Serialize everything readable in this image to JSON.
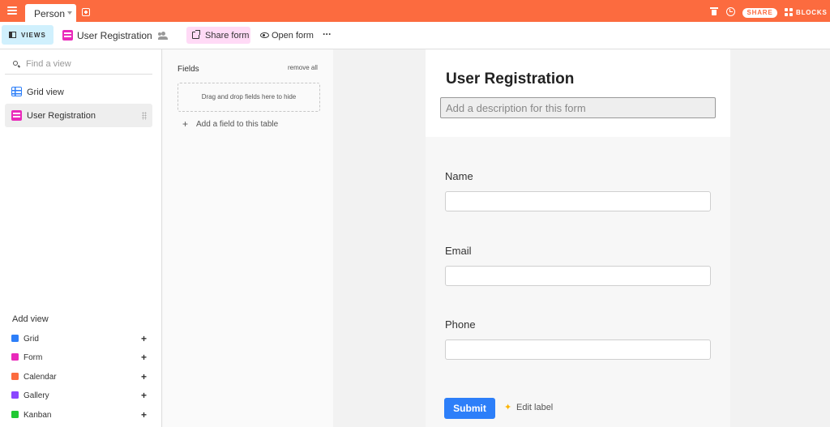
{
  "topbar": {
    "table_tab": "Person",
    "share": "SHARE",
    "blocks": "BLOCKS",
    "color": "#fc6b3f"
  },
  "viewbar": {
    "views": "VIEWS",
    "view_name": "User Registration",
    "share_form": "Share form",
    "open_form": "Open form",
    "more": "···"
  },
  "sidebar": {
    "find_placeholder": "Find a view",
    "views": [
      {
        "label": "Grid view",
        "icon": "grid-icon",
        "active": false
      },
      {
        "label": "User Registration",
        "icon": "form-icon",
        "active": true
      }
    ],
    "add_view_title": "Add view",
    "add_items": [
      {
        "label": "Grid",
        "icon": "grid-icon",
        "color": "#2d7ff9"
      },
      {
        "label": "Form",
        "icon": "form-icon",
        "color": "#e929ba"
      },
      {
        "label": "Calendar",
        "icon": "calendar-icon",
        "color": "#fc6b3f"
      },
      {
        "label": "Gallery",
        "icon": "gallery-icon",
        "color": "#8b46ff"
      },
      {
        "label": "Kanban",
        "icon": "kanban-icon",
        "color": "#20c933"
      }
    ]
  },
  "fields_panel": {
    "title": "Fields",
    "remove_all": "remove all",
    "drop_hint": "Drag and drop fields here to hide",
    "add_field": "Add a field to this table"
  },
  "form": {
    "title": "User Registration",
    "description_placeholder": "Add a description for this form",
    "fields": [
      {
        "label": "Name",
        "value": ""
      },
      {
        "label": "Email",
        "value": ""
      },
      {
        "label": "Phone",
        "value": ""
      }
    ],
    "submit": "Submit",
    "edit_label": "Edit label"
  }
}
